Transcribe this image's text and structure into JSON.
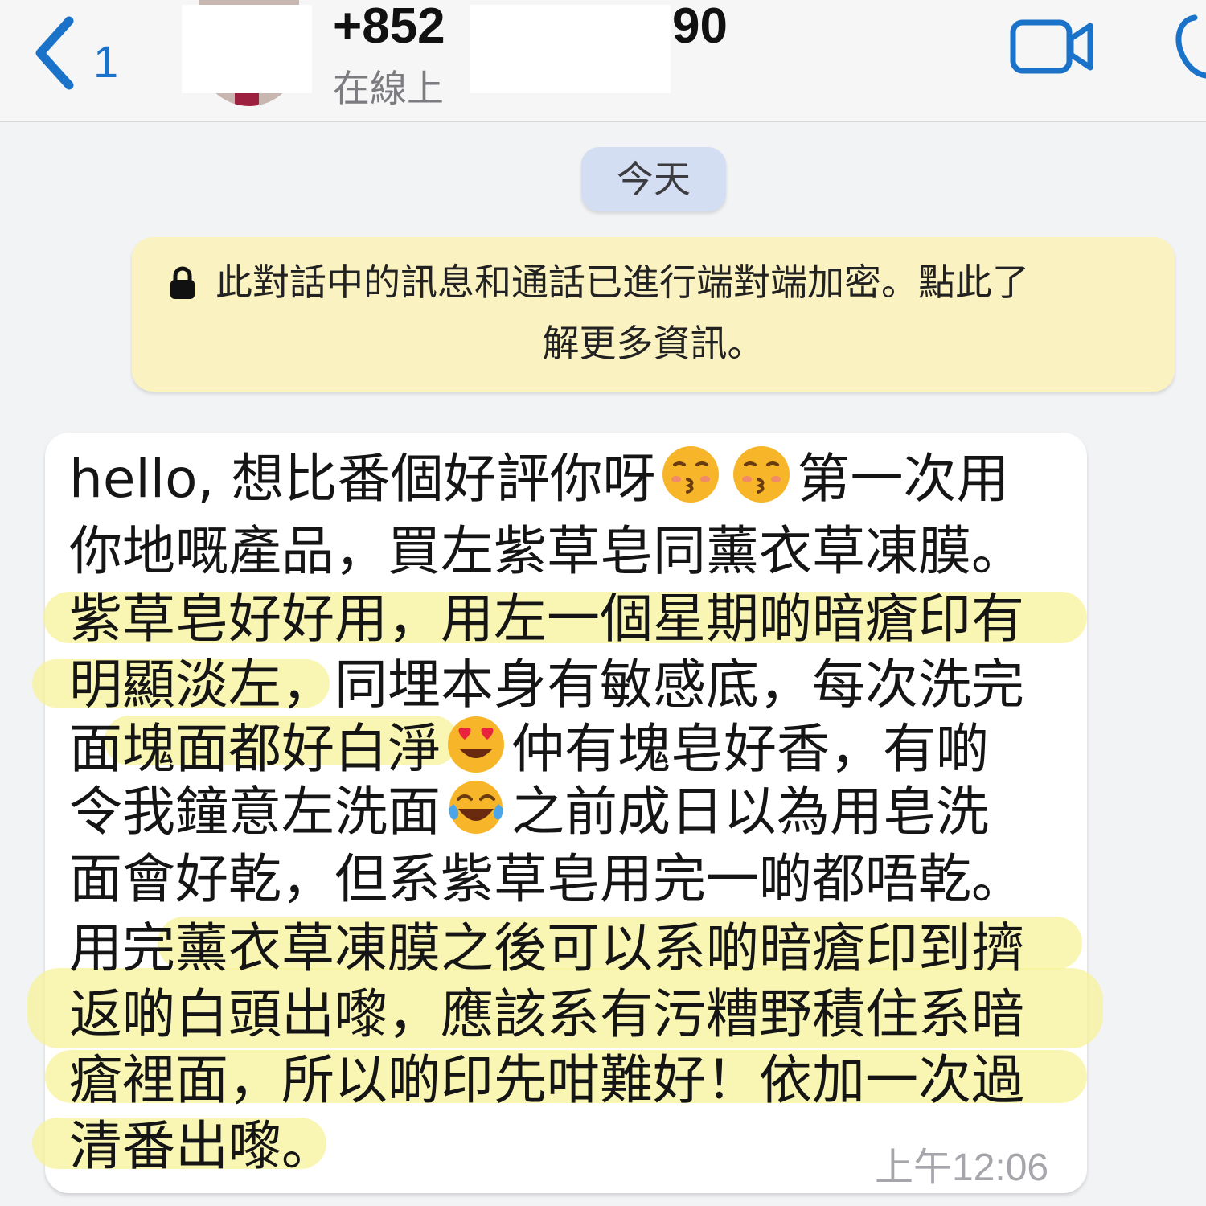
{
  "header": {
    "back_count": "1",
    "phone_prefix": "+852",
    "phone_suffix": "90",
    "status": "在線上"
  },
  "date_chip": "今天",
  "encryption_notice": {
    "line1": "此對話中的訊息和通話已進行端對端加密。點此了",
    "line2": "解更多資訊。"
  },
  "message": {
    "lines": [
      {
        "a": "hello, 想比番個好評你呀",
        "b": "",
        "c": "第一次用"
      },
      {
        "a": "你地嘅產品，買左紫草皂同薰衣草凍膜。"
      },
      {
        "a": "紫草皂好好用，用左一個星期啲暗瘡印有"
      },
      {
        "a": "明顯淡左，同埋本身有敏感底，每次洗完"
      },
      {
        "a": "面塊面都好白淨",
        "b": "仲有塊皂好香，有啲"
      },
      {
        "a": "令我鐘意左洗面",
        "b": "之前成日以為用皂洗"
      },
      {
        "a": "面會好乾，但系紫草皂用完一啲都唔乾。"
      },
      {
        "a": "用完薰衣草凍膜之後可以系啲暗瘡印到擠"
      },
      {
        "a": "返啲白頭出嚟，應該系有污糟野積住系暗"
      },
      {
        "a": "瘡裡面，所以啲印先咁難好！依加一次過"
      },
      {
        "a": "清番出嚟。"
      }
    ],
    "time": "上午12:06"
  },
  "icons": {
    "back": "chevron-left-icon",
    "video": "video-camera-icon",
    "call": "phone-icon",
    "lock": "lock-icon",
    "emoji_kiss": "kissing-face-emoji",
    "emoji_heart_eyes": "heart-eyes-emoji",
    "emoji_joy": "tears-of-joy-emoji"
  },
  "colors": {
    "accent": "#1a73c9",
    "highlight": "#f6f296",
    "notice_bg": "#fbf2c2",
    "date_chip_bg": "#d4def2"
  }
}
